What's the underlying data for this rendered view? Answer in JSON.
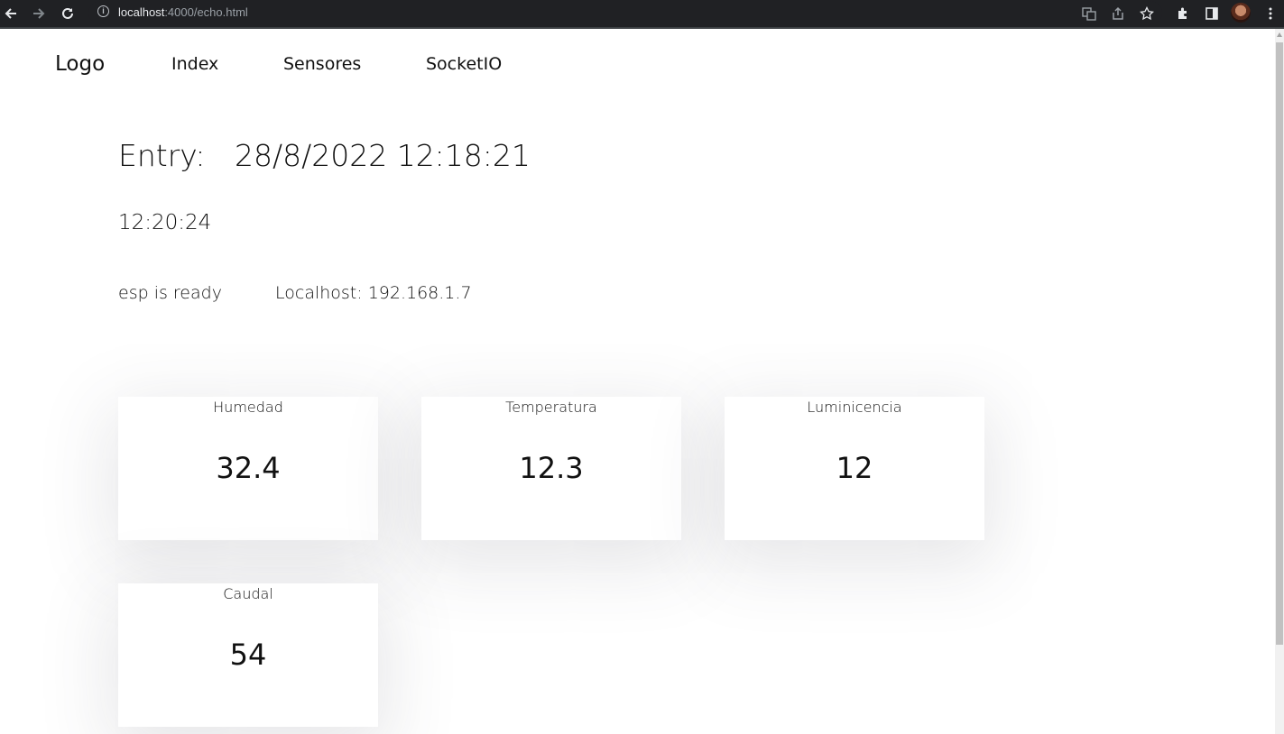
{
  "browser": {
    "url_host": "localhost",
    "url_path": ":4000/echo.html",
    "icons": [
      "back-icon",
      "forward-icon",
      "reload-icon",
      "info-icon",
      "translate-icon",
      "share-icon",
      "star-icon",
      "extensions-icon",
      "side-panel-icon",
      "avatar",
      "menu-icon"
    ]
  },
  "nav": {
    "logo": "Logo",
    "links": [
      "Index",
      "Sensores",
      "SocketIO"
    ]
  },
  "header": {
    "entry_label": "Entry:",
    "entry_value": "28/8/2022 12:18:21",
    "clock": "12:20:24",
    "status": "esp is ready",
    "localhost": "Localhost: 192.168.1.7"
  },
  "cards": [
    {
      "title": "Humedad",
      "value": "32.4"
    },
    {
      "title": "Temperatura",
      "value": "12.3"
    },
    {
      "title": "Luminicencia",
      "value": "12"
    },
    {
      "title": "Caudal",
      "value": "54"
    }
  ]
}
